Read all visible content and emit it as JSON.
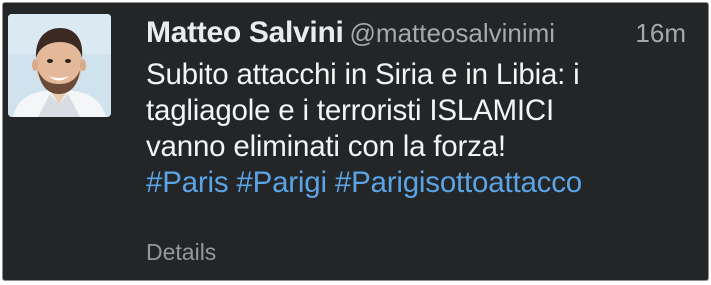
{
  "tweet": {
    "author": {
      "display_name": "Matteo Salvini",
      "handle": "@matteosalvinimi",
      "avatar_icon": "profile-photo"
    },
    "timestamp": "16m",
    "text_lines": [
      "Subito attacchi in Siria e in Libia: i",
      "tagliagole e i terroristi ISLAMICI",
      "vanno eliminati con la forza!"
    ],
    "hashtags": [
      "#Paris",
      "#Parigi",
      "#Parigisottoattacco"
    ],
    "details_label": "Details"
  },
  "colors": {
    "background": "#232526",
    "hashtag": "#5aa4e6",
    "muted_text": "#a6a8aa"
  }
}
